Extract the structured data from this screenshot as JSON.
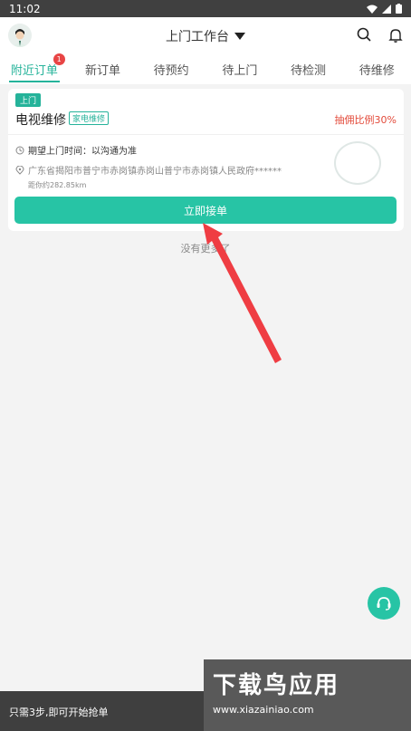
{
  "status": {
    "time": "11:02"
  },
  "header": {
    "title": "上门工作台",
    "dropdown_icon": "triangle-down-icon",
    "search_icon": "search-icon",
    "bell_icon": "bell-icon"
  },
  "tabs": [
    {
      "label": "附近订单",
      "active": true,
      "badge": "1"
    },
    {
      "label": "新订单"
    },
    {
      "label": "待预约"
    },
    {
      "label": "待上门"
    },
    {
      "label": "待检测"
    },
    {
      "label": "待维修"
    }
  ],
  "order": {
    "tag": "上门",
    "title": "电视维修",
    "category": "家电维修",
    "commission": "抽佣比例30%",
    "expected_time": "期望上门时间：以沟通为准",
    "address": "广东省揭阳市普宁市赤岗镇赤岗山普宁市赤岗镇人民政府******",
    "distance": "距你约282.85km",
    "accept_button": "立即接单"
  },
  "footer": {
    "no_more": "没有更多了",
    "hint": "只需3步,即可开始抢单",
    "watermark": "下载鸟应用",
    "watermark_url": "www.xiazainiao.com"
  },
  "colors": {
    "accent": "#27c4a5",
    "red": "#e34a3a"
  }
}
